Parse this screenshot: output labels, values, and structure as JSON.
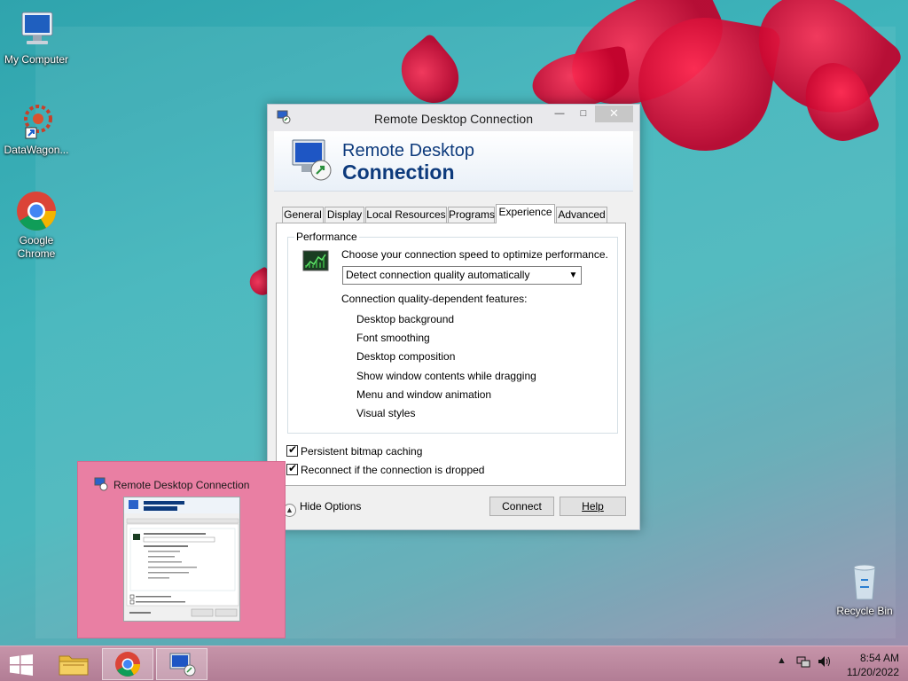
{
  "desktop": {
    "icons": [
      {
        "label": "My Computer"
      },
      {
        "label": "DataWagon..."
      },
      {
        "label": "Google Chrome"
      },
      {
        "label": "Recycle Bin"
      }
    ]
  },
  "window": {
    "title": "Remote Desktop Connection",
    "banner_line1": "Remote Desktop",
    "banner_line2": "Connection",
    "tabs": [
      {
        "label": "General"
      },
      {
        "label": "Display"
      },
      {
        "label": "Local Resources"
      },
      {
        "label": "Programs"
      },
      {
        "label": "Experience"
      },
      {
        "label": "Advanced"
      }
    ],
    "active_tab": "Experience",
    "performance": {
      "legend": "Performance",
      "speed_label": "Choose your connection speed to optimize performance.",
      "speed_value": "Detect connection quality automatically",
      "features_heading": "Connection quality-dependent features:",
      "features": [
        "Desktop background",
        "Font smoothing",
        "Desktop composition",
        "Show window contents while dragging",
        "Menu and window animation",
        "Visual styles"
      ]
    },
    "checkboxes": [
      {
        "label": "Persistent bitmap caching",
        "checked": true
      },
      {
        "label": "Reconnect if the connection is dropped",
        "checked": true
      }
    ],
    "hide_options": "Hide Options",
    "connect": "Connect",
    "help": "Help"
  },
  "preview": {
    "title": "Remote Desktop Connection"
  },
  "taskbar": {
    "time": "8:54 AM",
    "date": "11/20/2022"
  },
  "colors": {
    "banner_text": "#0d3a7c",
    "preview_bg": "#e97fa3",
    "taskbar": "#b27d95"
  }
}
